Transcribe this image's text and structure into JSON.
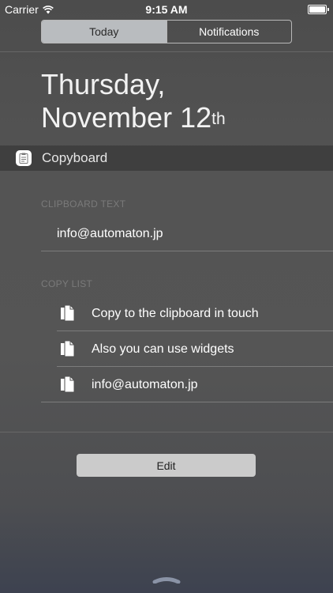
{
  "status_bar": {
    "carrier": "Carrier",
    "time": "9:15 AM"
  },
  "tabs": [
    {
      "label": "Today",
      "selected": true
    },
    {
      "label": "Notifications",
      "selected": false
    }
  ],
  "date": {
    "line1": "Thursday,",
    "line2": "November 12",
    "suffix": "th"
  },
  "widget": {
    "title": "Copyboard",
    "icon": "clipboard-icon",
    "clipboard_section_label": "CLIPBOARD TEXT",
    "clipboard_text": "info@automaton.jp",
    "copy_list_label": "COPY LIST",
    "copy_list": [
      {
        "label": "Copy to the clipboard in touch",
        "icon": "document-copy-icon"
      },
      {
        "label": "Also you can use widgets",
        "icon": "document-copy-icon"
      },
      {
        "label": "info@automaton.jp",
        "icon": "document-copy-icon"
      }
    ]
  },
  "edit_label": "Edit",
  "colors": {
    "background": "#555555",
    "header_band": "#3f3f3f",
    "segment_active": "#b9bcbf",
    "edit_button": "#cbcbcb"
  }
}
